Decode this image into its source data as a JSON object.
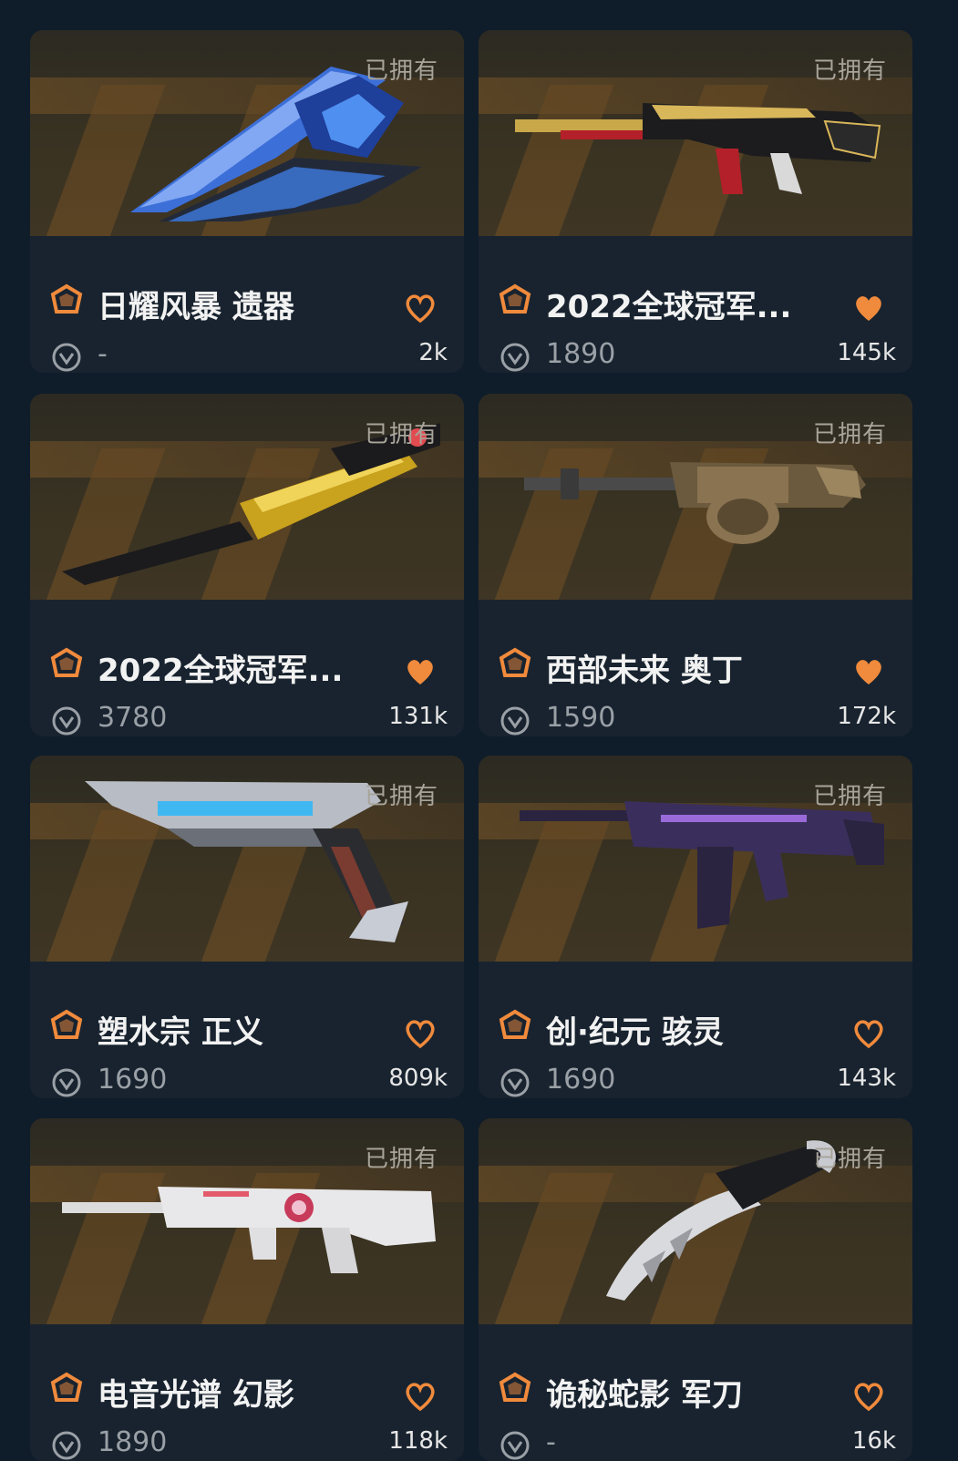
{
  "owned_label": "已拥有",
  "colors": {
    "accent": "#f08a3c",
    "background": "#0f1c2a",
    "card": "#18232f"
  },
  "cards": [
    {
      "name": "日耀风暴 遗器",
      "price": "-",
      "likes": "2k",
      "liked": false
    },
    {
      "name": "2022全球冠军...",
      "price": "1890",
      "likes": "145k",
      "liked": true
    },
    {
      "name": "2022全球冠军...",
      "price": "3780",
      "likes": "131k",
      "liked": true
    },
    {
      "name": "西部未来 奥丁",
      "price": "1590",
      "likes": "172k",
      "liked": true
    },
    {
      "name": "塑水宗 正义",
      "price": "1690",
      "likes": "809k",
      "liked": false
    },
    {
      "name": "创·纪元 骇灵",
      "price": "1690",
      "likes": "143k",
      "liked": false
    },
    {
      "name": "电音光谱 幻影",
      "price": "1890",
      "likes": "118k",
      "liked": false
    },
    {
      "name": "诡秘蛇影 军刀",
      "price": "-",
      "likes": "16k",
      "liked": false
    }
  ]
}
